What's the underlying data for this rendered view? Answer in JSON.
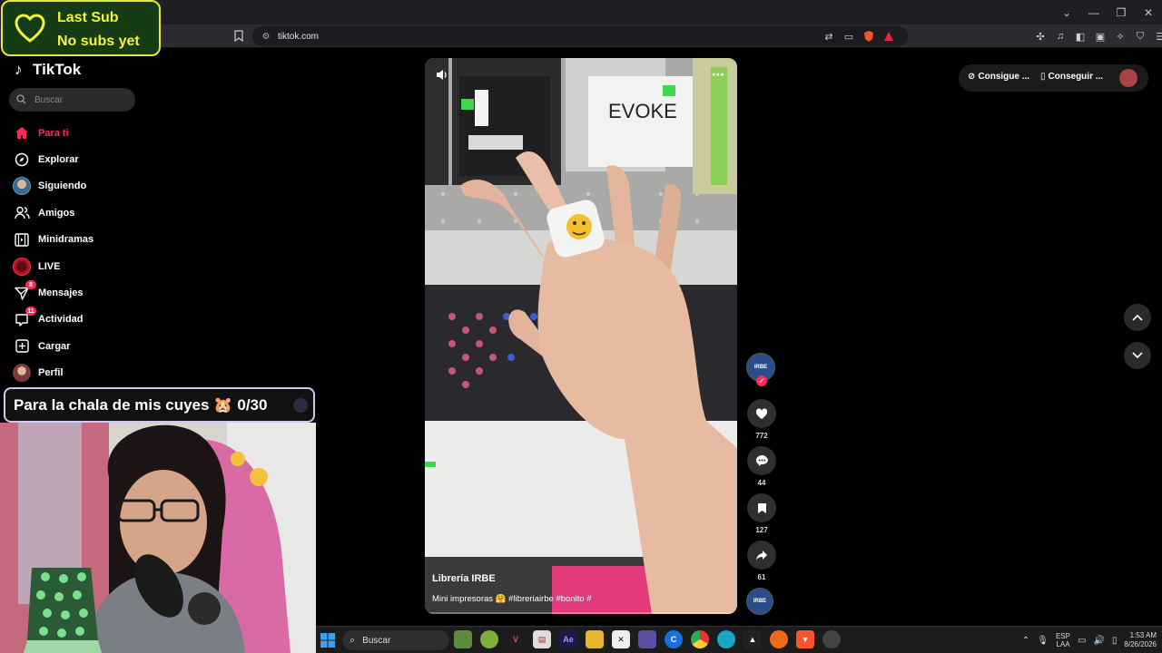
{
  "browser": {
    "url": "tiktok.com",
    "window_controls": [
      "chevron-down",
      "minimize",
      "restore",
      "close"
    ]
  },
  "overlay_last_sub": {
    "line1": "Last Sub",
    "line2": "No subs yet"
  },
  "tiktok": {
    "brand": "TikTok",
    "search_placeholder": "Buscar",
    "nav": [
      {
        "label": "Para ti",
        "icon": "home-icon",
        "active": true
      },
      {
        "label": "Explorar",
        "icon": "compass-icon"
      },
      {
        "label": "Siguiendo",
        "icon": "avatar"
      },
      {
        "label": "Amigos",
        "icon": "friends-icon"
      },
      {
        "label": "Minidramas",
        "icon": "film-icon"
      },
      {
        "label": "LIVE",
        "icon": "live-icon"
      },
      {
        "label": "Mensajes",
        "icon": "send-icon",
        "badge": "8"
      },
      {
        "label": "Actividad",
        "icon": "inbox-icon",
        "badge": "11"
      },
      {
        "label": "Cargar",
        "icon": "upload-icon"
      },
      {
        "label": "Perfil",
        "icon": "avatar"
      }
    ],
    "video": {
      "author": "Librería IRBE",
      "description": "Mini impresoras 🤗 #libreriairbe #bonito #"
    },
    "actions": {
      "author_badge": "IRBE",
      "likes": "772",
      "comments": "44",
      "saves": "127",
      "shares": "61"
    },
    "top_right": {
      "coins_label": "Consigue ...",
      "app_label": "Conseguir ..."
    }
  },
  "overlay_goal": {
    "text": "Para la chala de mis cuyes 🐹",
    "progress": "0/30"
  },
  "taskbar": {
    "search_label": "Buscar",
    "lang_line1": "ESP",
    "lang_line2": "LAA",
    "time": "1:53 AM",
    "date": "8/26/2026"
  }
}
